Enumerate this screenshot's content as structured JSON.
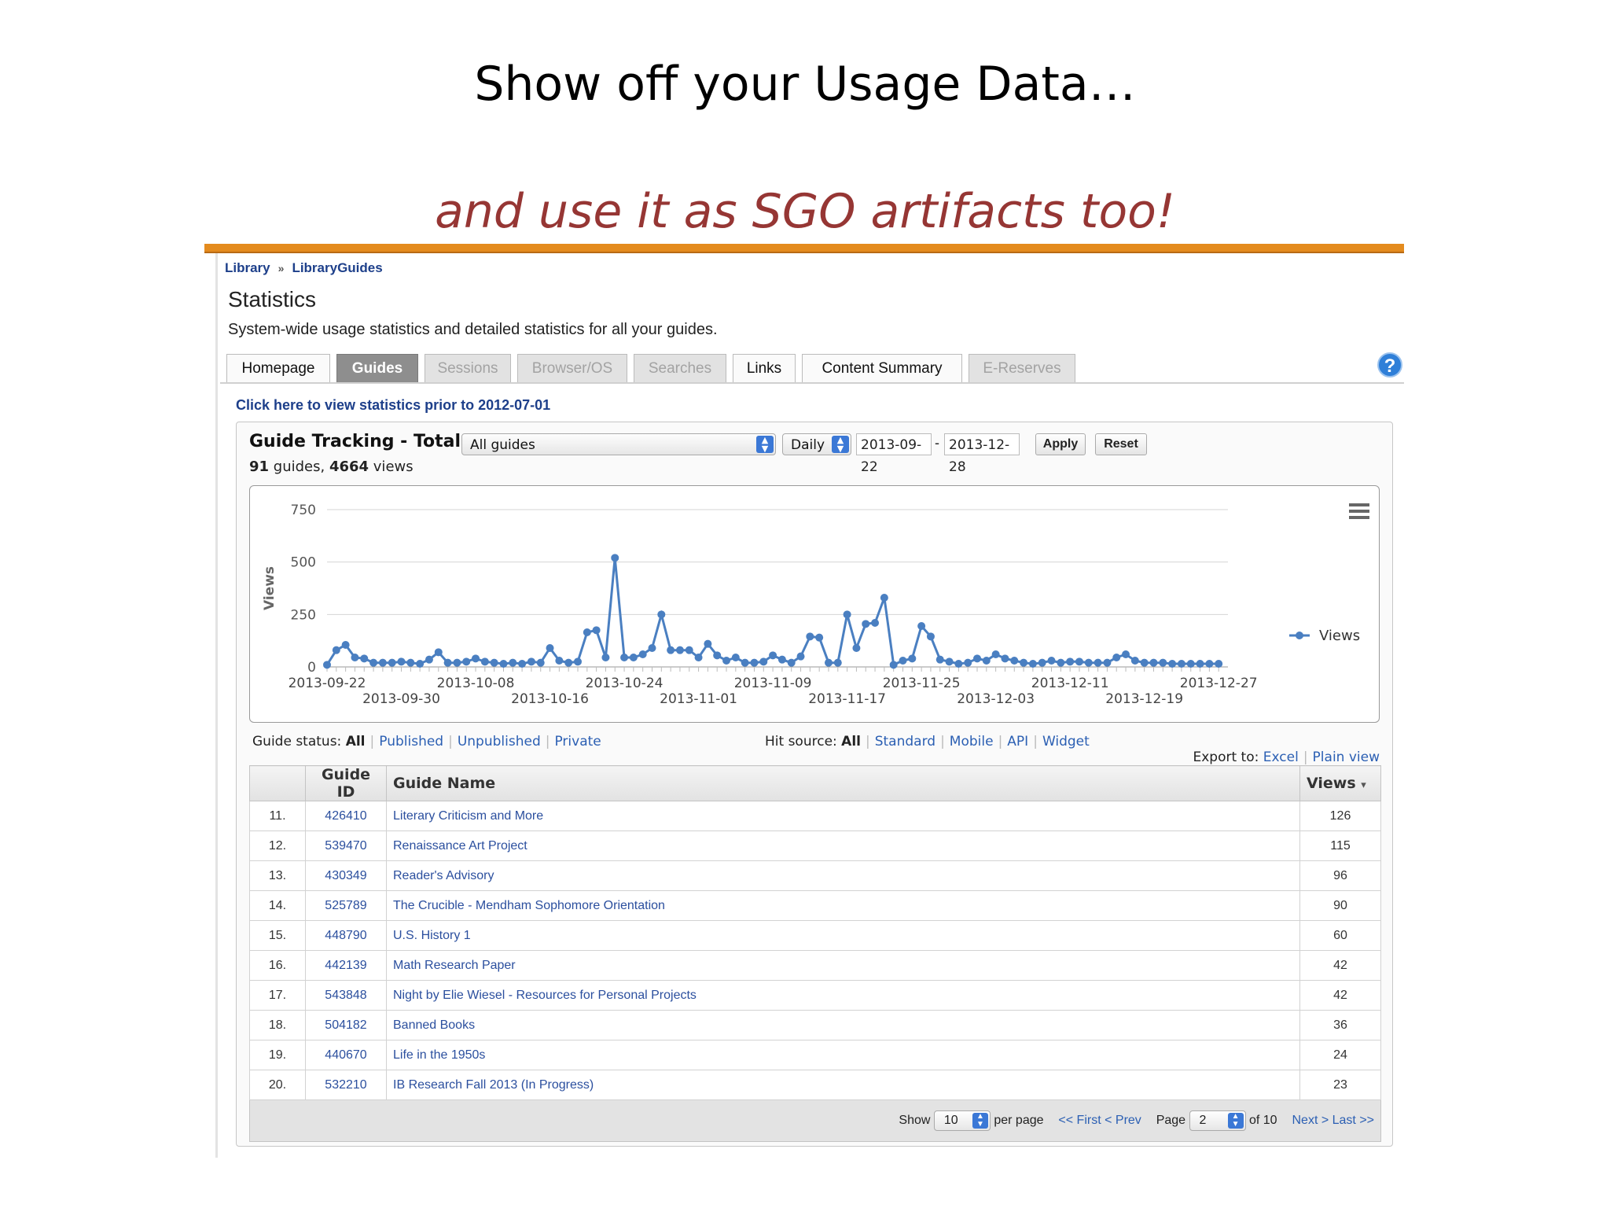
{
  "slide": {
    "title": "Show off your Usage Data…",
    "subtitle": "and use it as SGO artifacts too!",
    "accent_color": "#e48b1e",
    "subtitle_color": "#963634"
  },
  "breadcrumb": {
    "items": [
      "Library",
      "LibraryGuides"
    ],
    "separator": "»"
  },
  "page": {
    "title": "Statistics",
    "description": "System-wide usage statistics and detailed statistics for all your guides."
  },
  "tabs": [
    {
      "label": "Homepage",
      "state": "normal"
    },
    {
      "label": "Guides",
      "state": "active"
    },
    {
      "label": "Sessions",
      "state": "disabled"
    },
    {
      "label": "Browser/OS",
      "state": "disabled"
    },
    {
      "label": "Searches",
      "state": "disabled"
    },
    {
      "label": "Links",
      "state": "normal"
    },
    {
      "label": "Content Summary",
      "state": "normal"
    },
    {
      "label": "E-Reserves",
      "state": "disabled"
    }
  ],
  "help_icon": {
    "glyph": "?"
  },
  "prior_link": "Click here to view statistics prior to 2012-07-01",
  "tracking": {
    "title": "Guide Tracking - Total Views",
    "guide_select": "All guides",
    "period_select": "Daily",
    "date_from": "2013-09-22",
    "date_sep": "-",
    "date_to": "2013-12-28",
    "apply_label": "Apply",
    "reset_label": "Reset",
    "guides_count": "91",
    "guides_word": " guides, ",
    "views_count": "4664",
    "views_word": " views"
  },
  "chart_data": {
    "type": "line",
    "ylabel": "Views",
    "ylim": [
      0,
      750
    ],
    "yticks": [
      0,
      250,
      500,
      750
    ],
    "xlim": [
      "2013-09-22",
      "2013-12-28"
    ],
    "x_ticks_row1": [
      "2013-09-22",
      "2013-10-08",
      "2013-10-24",
      "2013-11-09",
      "2013-11-25",
      "2013-12-11",
      "2013-12-27"
    ],
    "x_ticks_row2": [
      "2013-09-30",
      "2013-10-16",
      "2013-11-01",
      "2013-11-17",
      "2013-12-03",
      "2013-12-19"
    ],
    "grid": true,
    "legend": "right",
    "menu_icon": "hamburger-menu-icon",
    "color": "#4a7fc1",
    "series": [
      {
        "name": "Views",
        "x": [
          "2013-09-22",
          "2013-09-23",
          "2013-09-24",
          "2013-09-25",
          "2013-09-26",
          "2013-09-27",
          "2013-09-28",
          "2013-09-29",
          "2013-09-30",
          "2013-10-01",
          "2013-10-02",
          "2013-10-03",
          "2013-10-04",
          "2013-10-05",
          "2013-10-06",
          "2013-10-07",
          "2013-10-08",
          "2013-10-09",
          "2013-10-10",
          "2013-10-11",
          "2013-10-12",
          "2013-10-13",
          "2013-10-14",
          "2013-10-15",
          "2013-10-16",
          "2013-10-17",
          "2013-10-18",
          "2013-10-19",
          "2013-10-20",
          "2013-10-21",
          "2013-10-22",
          "2013-10-23",
          "2013-10-24",
          "2013-10-25",
          "2013-10-26",
          "2013-10-27",
          "2013-10-28",
          "2013-10-29",
          "2013-10-30",
          "2013-10-31",
          "2013-11-01",
          "2013-11-02",
          "2013-11-03",
          "2013-11-04",
          "2013-11-05",
          "2013-11-06",
          "2013-11-07",
          "2013-11-08",
          "2013-11-09",
          "2013-11-10",
          "2013-11-11",
          "2013-11-12",
          "2013-11-13",
          "2013-11-14",
          "2013-11-15",
          "2013-11-16",
          "2013-11-17",
          "2013-11-18",
          "2013-11-19",
          "2013-11-20",
          "2013-11-21",
          "2013-11-22",
          "2013-11-23",
          "2013-11-24",
          "2013-11-25",
          "2013-11-26",
          "2013-11-27",
          "2013-11-28",
          "2013-11-29",
          "2013-11-30",
          "2013-12-01",
          "2013-12-02",
          "2013-12-03",
          "2013-12-04",
          "2013-12-05",
          "2013-12-06",
          "2013-12-07",
          "2013-12-08",
          "2013-12-09",
          "2013-12-10",
          "2013-12-11",
          "2013-12-12",
          "2013-12-13",
          "2013-12-14",
          "2013-12-15",
          "2013-12-16",
          "2013-12-17",
          "2013-12-18",
          "2013-12-19",
          "2013-12-20",
          "2013-12-21",
          "2013-12-22",
          "2013-12-23",
          "2013-12-24",
          "2013-12-25",
          "2013-12-26",
          "2013-12-27"
        ],
        "values": [
          10,
          80,
          105,
          45,
          40,
          20,
          20,
          20,
          25,
          20,
          15,
          35,
          70,
          20,
          20,
          25,
          40,
          25,
          20,
          15,
          20,
          15,
          25,
          20,
          90,
          30,
          20,
          25,
          165,
          175,
          45,
          520,
          45,
          45,
          60,
          90,
          250,
          80,
          80,
          80,
          45,
          110,
          55,
          30,
          45,
          20,
          20,
          25,
          55,
          35,
          20,
          50,
          145,
          140,
          20,
          20,
          250,
          90,
          205,
          210,
          330,
          10,
          30,
          40,
          195,
          145,
          35,
          25,
          15,
          20,
          40,
          30,
          60,
          40,
          30,
          20,
          15,
          20,
          30,
          20,
          25,
          25,
          20,
          20,
          20,
          45,
          60,
          30,
          20,
          20,
          20,
          15,
          15,
          15,
          15,
          15,
          15
        ]
      }
    ]
  },
  "filters": {
    "status_label": "Guide status:",
    "status_options": [
      "All",
      "Published",
      "Unpublished",
      "Private"
    ],
    "hit_label": "Hit source:",
    "hit_options": [
      "All",
      "Standard",
      "Mobile",
      "API",
      "Widget"
    ],
    "export_label": "Export to:",
    "export_options": [
      "Excel",
      "Plain view"
    ]
  },
  "table": {
    "headers": {
      "num": "",
      "id": "Guide ID",
      "name": "Guide Name",
      "views": "Views",
      "sort_glyph": "▾"
    },
    "rows": [
      {
        "num": "11.",
        "id": "426410",
        "name": "Literary Criticism and More",
        "views": "126"
      },
      {
        "num": "12.",
        "id": "539470",
        "name": "Renaissance Art Project",
        "views": "115"
      },
      {
        "num": "13.",
        "id": "430349",
        "name": "Reader's Advisory",
        "views": "96"
      },
      {
        "num": "14.",
        "id": "525789",
        "name": "The Crucible - Mendham Sophomore Orientation",
        "views": "90"
      },
      {
        "num": "15.",
        "id": "448790",
        "name": "U.S. History 1",
        "views": "60"
      },
      {
        "num": "16.",
        "id": "442139",
        "name": "Math Research Paper",
        "views": "42"
      },
      {
        "num": "17.",
        "id": "543848",
        "name": "Night by Elie Wiesel - Resources for Personal Projects",
        "views": "42"
      },
      {
        "num": "18.",
        "id": "504182",
        "name": "Banned Books",
        "views": "36"
      },
      {
        "num": "19.",
        "id": "440670",
        "name": "Life in the 1950s",
        "views": "24"
      },
      {
        "num": "20.",
        "id": "532210",
        "name": "IB Research Fall 2013 (In Progress)",
        "views": "23"
      }
    ]
  },
  "pager": {
    "show_label": "Show",
    "per_page_value": "10",
    "per_page_label": "per page",
    "first_label": "<< First",
    "prev_label": "< Prev",
    "page_label": "Page",
    "page_value": "2",
    "of_label": "of 10",
    "next_label": "Next >",
    "last_label": "Last >>"
  }
}
